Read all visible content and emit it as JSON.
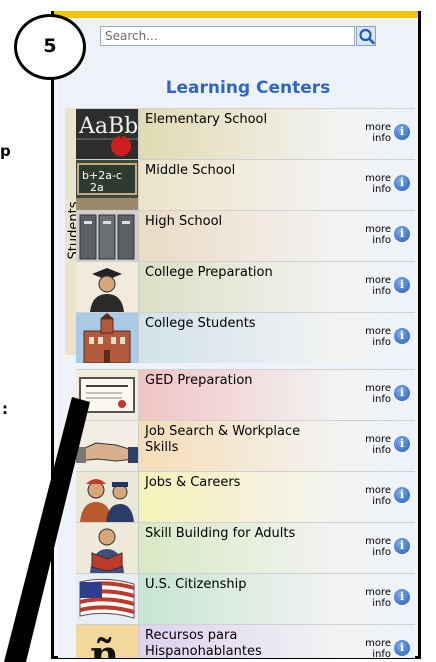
{
  "annotation": {
    "step_number": "5",
    "fragment_p": "p",
    "fragment_colon": ":"
  },
  "search": {
    "placeholder": "Search..."
  },
  "panel": {
    "title": "Learning Centers",
    "group_label": "Students"
  },
  "more_info": {
    "line1": "more",
    "line2": "info"
  },
  "items": [
    {
      "label": "Elementary School"
    },
    {
      "label": "Middle School"
    },
    {
      "label": "High School"
    },
    {
      "label": "College Preparation"
    },
    {
      "label": "College Students"
    },
    {
      "label": "GED Preparation"
    },
    {
      "label": "Job Search & Workplace Skills"
    },
    {
      "label": "Jobs & Careers"
    },
    {
      "label": "Skill Building for Adults"
    },
    {
      "label": "U.S. Citizenship"
    },
    {
      "label": "Recursos para Hispanohablantes"
    }
  ],
  "colors": {
    "accent": "#2f67c7",
    "topbar": "#f2c300",
    "row_gradients": [
      "#d9d39a",
      "#eadfbb",
      "#e8d3b5",
      "#d5d8b5",
      "#c7dde7",
      "#f0b5b5",
      "#f6d6a2",
      "#f8f1a6",
      "#cfe6b6",
      "#b9e1c8",
      "#d6c7ef"
    ]
  }
}
